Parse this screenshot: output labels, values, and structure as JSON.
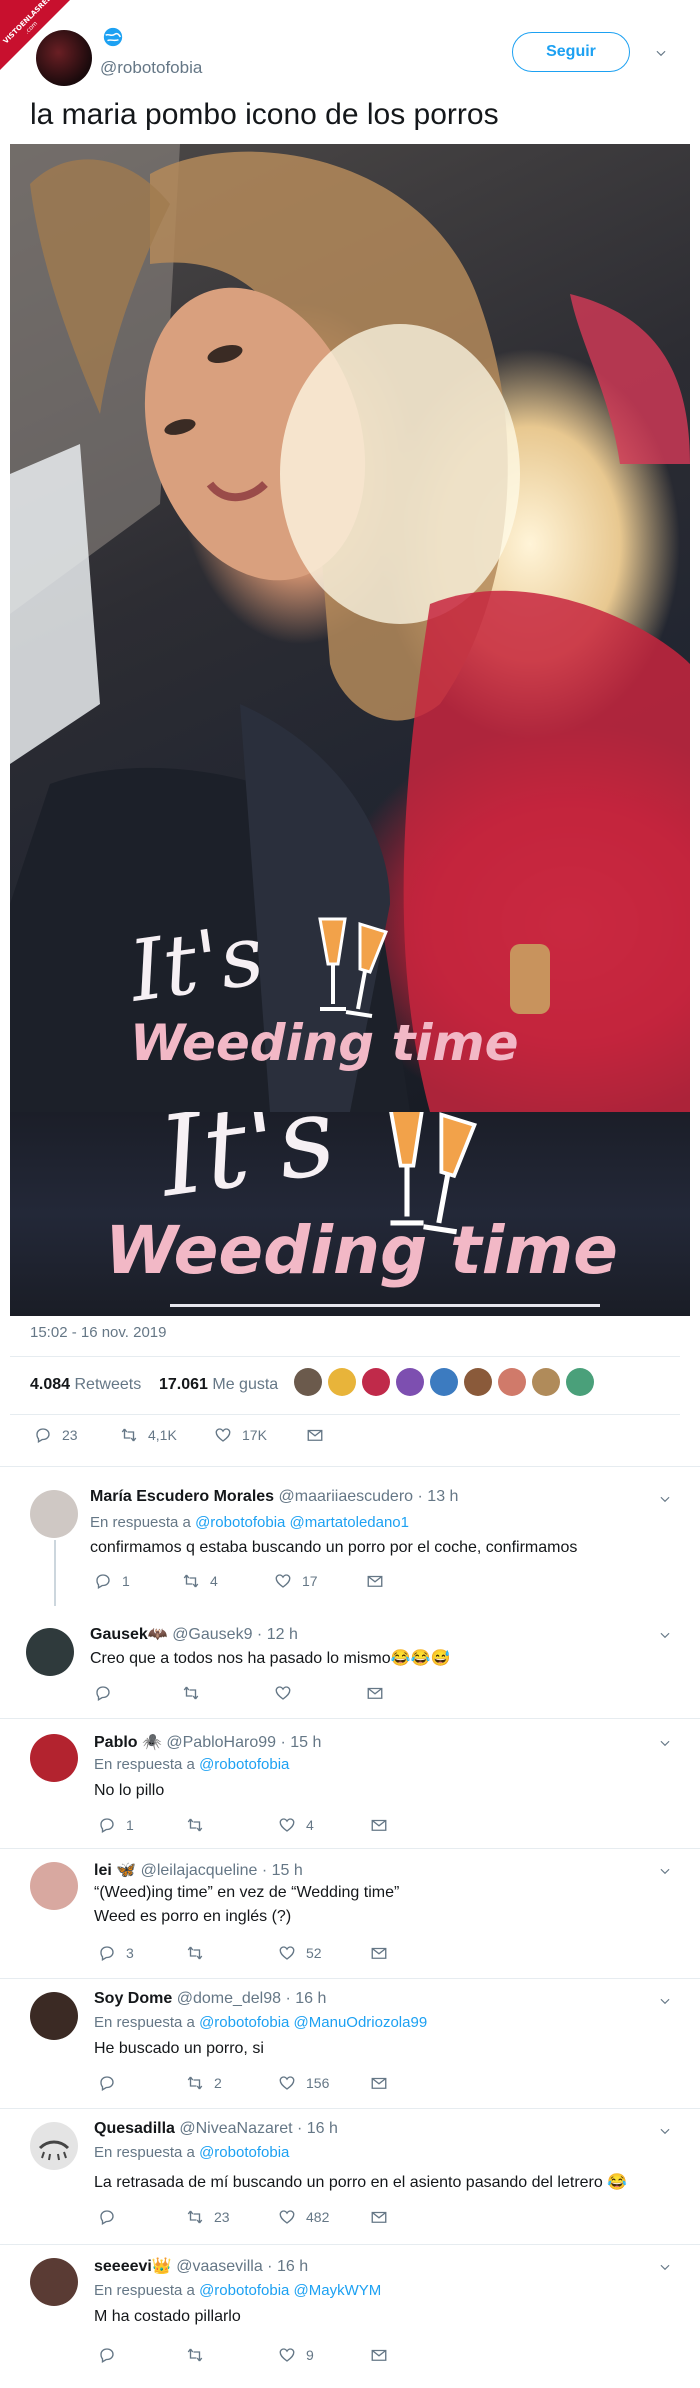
{
  "watermark": {
    "line1": "VISTOENLASREDES",
    "line2": ".com"
  },
  "tweet": {
    "handle": "@robotofobia",
    "follow_label": "Seguir",
    "text": "la maria pombo icono de los porros",
    "image_text": {
      "its": "It's",
      "weeding": "Weeding time"
    },
    "timestamp": "15:02 - 16 nov. 2019",
    "retweets_count": "4.084",
    "retweets_label": "Retweets",
    "likes_count": "17.061",
    "likes_label": "Me gusta",
    "actions": {
      "reply": "23",
      "retweet": "4,1K",
      "like": "17K"
    }
  },
  "colors": {
    "accent": "#1da1f2",
    "muted": "#657786",
    "divider": "#e6ecf0"
  },
  "replies": [
    {
      "name": "María Escudero Morales",
      "handle": "@maariiaescudero",
      "time": "· 13 h",
      "in_reply_prefix": "En respuesta a",
      "in_reply_to": "@robotofobia @martatoledano1",
      "text": "confirmamos q estaba buscando un porro por el coche, confirmamos",
      "counts": {
        "reply": "1",
        "retweet": "4",
        "like": "17"
      }
    },
    {
      "name": "Gausek🦇",
      "handle": "@Gausek9",
      "time": "· 12 h",
      "text": "Creo que a todos nos ha pasado lo mismo😂😂😅",
      "counts": {
        "reply": "",
        "retweet": "",
        "like": ""
      }
    },
    {
      "name": "Pablo 🕷️",
      "handle": "@PabloHaro99",
      "time": "· 15 h",
      "in_reply_prefix": "En respuesta a",
      "in_reply_to": "@robotofobia",
      "text": "No lo pillo",
      "counts": {
        "reply": "1",
        "retweet": "",
        "like": "4"
      }
    },
    {
      "name": "lei 🦋",
      "handle": "@leilajacqueline",
      "time": "· 15 h",
      "text": "“(Weed)ing time” en vez de “Wedding time”",
      "text2": "Weed es porro en inglés (?)",
      "counts": {
        "reply": "3",
        "retweet": "",
        "like": "52"
      }
    },
    {
      "name": "Soy Dome",
      "handle": "@dome_del98",
      "time": "· 16 h",
      "in_reply_prefix": "En respuesta a",
      "in_reply_to": "@robotofobia @ManuOdriozola99",
      "text": "He buscado un porro, si",
      "counts": {
        "reply": "",
        "retweet": "2",
        "like": "156"
      }
    },
    {
      "name": "Quesadilla",
      "handle": "@NiveaNazaret",
      "time": "· 16 h",
      "in_reply_prefix": "En respuesta a",
      "in_reply_to": "@robotofobia",
      "text": "La retrasada de mí buscando un porro en el asiento pasando del letrero 😂",
      "counts": {
        "reply": "",
        "retweet": "23",
        "like": "482"
      }
    },
    {
      "name": "seeeevi👑",
      "handle": "@vaasevilla",
      "time": "· 16 h",
      "in_reply_prefix": "En respuesta a",
      "in_reply_to": "@robotofobia @MaykWYM",
      "text": "M ha costado pillarlo",
      "counts": {
        "reply": "",
        "retweet": "",
        "like": "9"
      }
    }
  ]
}
